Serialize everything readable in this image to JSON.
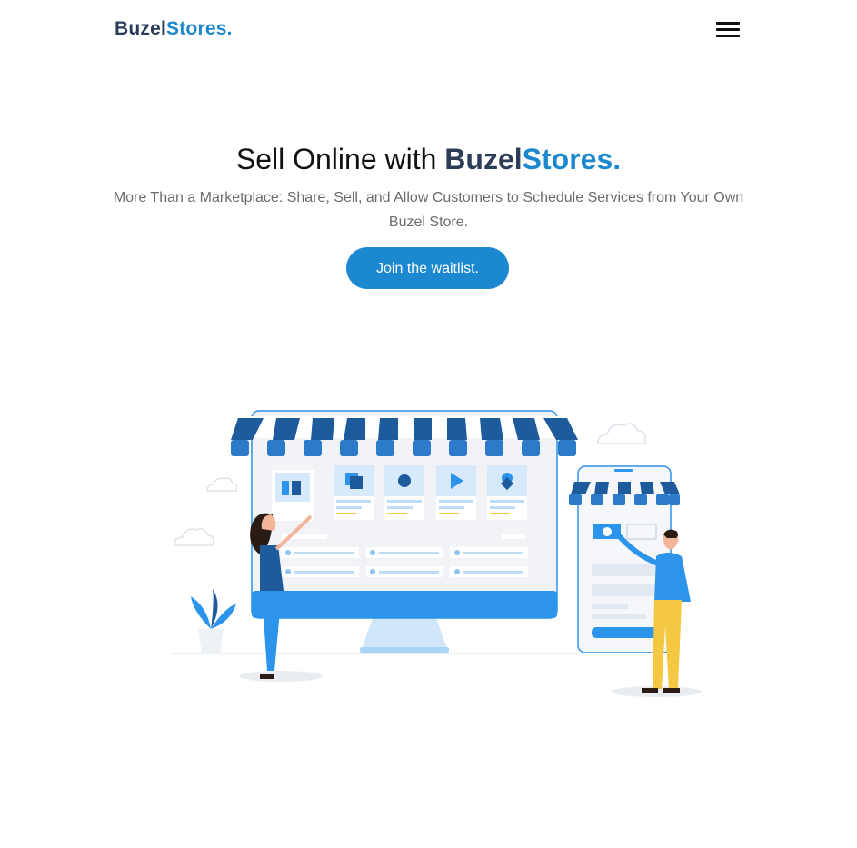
{
  "header": {
    "logo_part1": "Buzel",
    "logo_part2": "Stores.",
    "menu_icon": "hamburger-menu-icon"
  },
  "hero": {
    "title_prefix": "Sell Online with ",
    "title_brand1": "Buzel",
    "title_brand2": "Stores.",
    "subtitle": "More Than a Marketplace: Share, Sell, and Allow Customers to Schedule Services from Your Own Buzel Store.",
    "cta_label": "Join the waitlist."
  },
  "illustration": {
    "icon": "online-storefront-illustration"
  },
  "colors": {
    "brand_dark": "#2c3e57",
    "brand_blue": "#1c88cf",
    "awning_blue": "#1e5b9c",
    "screen_blue": "#2c94ea"
  }
}
